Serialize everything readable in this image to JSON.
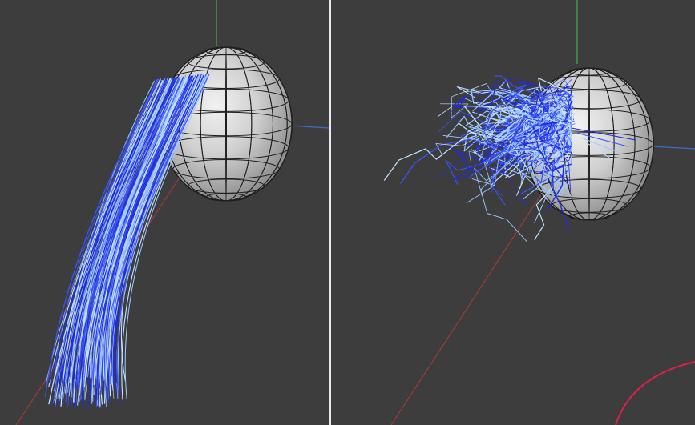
{
  "views": [
    {
      "id": "left",
      "label": "",
      "hair_state": "combed",
      "sphere": {
        "fill": "#cfcfcf",
        "wire": "#1e1e1e"
      },
      "hair_colors": [
        "#1f2bdc",
        "#3a55ff",
        "#9cc8ff",
        "#c4e0ff"
      ]
    },
    {
      "id": "right",
      "label": "",
      "hair_state": "tangled",
      "sphere": {
        "fill": "#cfcfcf",
        "wire": "#1e1e1e"
      },
      "hair_colors": [
        "#1f2bdc",
        "#3a55ff",
        "#9cc8ff",
        "#c4e0ff"
      ]
    }
  ],
  "axis_colors": {
    "x": "#b03a3a",
    "y": "#3fae5a",
    "z": "#3d6fc8"
  },
  "background": "#3d3d3d",
  "selection_curve_color": "#e0204a"
}
